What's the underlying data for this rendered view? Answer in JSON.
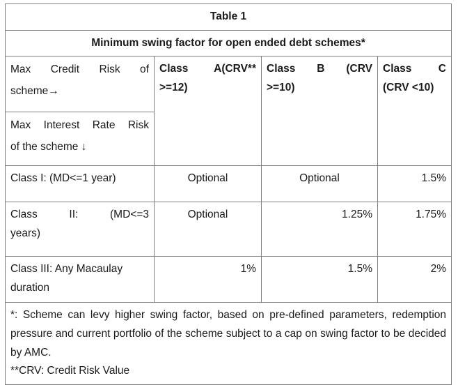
{
  "table": {
    "title": "Table 1",
    "subtitle": "Minimum swing factor for open ended debt schemes*",
    "corner": {
      "top_label": "Max Credit Risk of scheme→",
      "top_label_line1": "Max Credit Risk of",
      "top_label_line2": "scheme→",
      "bottom_label": "Max Interest Rate Risk of the scheme ↓",
      "bottom_label_line1": "Max Interest Rate Risk",
      "bottom_label_line2": "of the scheme ↓"
    },
    "column_headers": [
      {
        "line1": "Class A(CRV**",
        "line2": ">=12)",
        "full": "Class A(CRV** >=12)"
      },
      {
        "line1": "Class B (CRV",
        "line2": ">=10)",
        "full": "Class B (CRV >=10)"
      },
      {
        "line1": "Class C",
        "line2": "(CRV <10)",
        "full": "Class C (CRV <10)"
      }
    ],
    "rows": [
      {
        "label": "Class I: (MD<=1 year)",
        "label_line1": "Class I: (MD<=1 year)",
        "label_line2": "",
        "values": [
          "Optional",
          "Optional",
          "1.5%"
        ]
      },
      {
        "label": "Class II: (MD<=3 years)",
        "label_line1": "Class II: (MD<=3",
        "label_line2": "years)",
        "values": [
          "Optional",
          "1.25%",
          "1.75%"
        ]
      },
      {
        "label": "Class III: Any Macaulay duration",
        "label_line1": "Class III: Any Macaulay",
        "label_line2": "duration",
        "values": [
          "1%",
          "1.5%",
          "2%"
        ]
      }
    ],
    "notes": [
      "*: Scheme can levy higher swing factor, based on pre-defined parameters, redemption pressure and current portfolio of the scheme subject to a cap on swing factor to be decided by AMC.",
      "**CRV: Credit Risk Value"
    ]
  },
  "colors": {
    "border": "#7f7f7f",
    "outer_border": "#4a4a4a",
    "text": "#1a1a1a",
    "background": "#ffffff"
  }
}
